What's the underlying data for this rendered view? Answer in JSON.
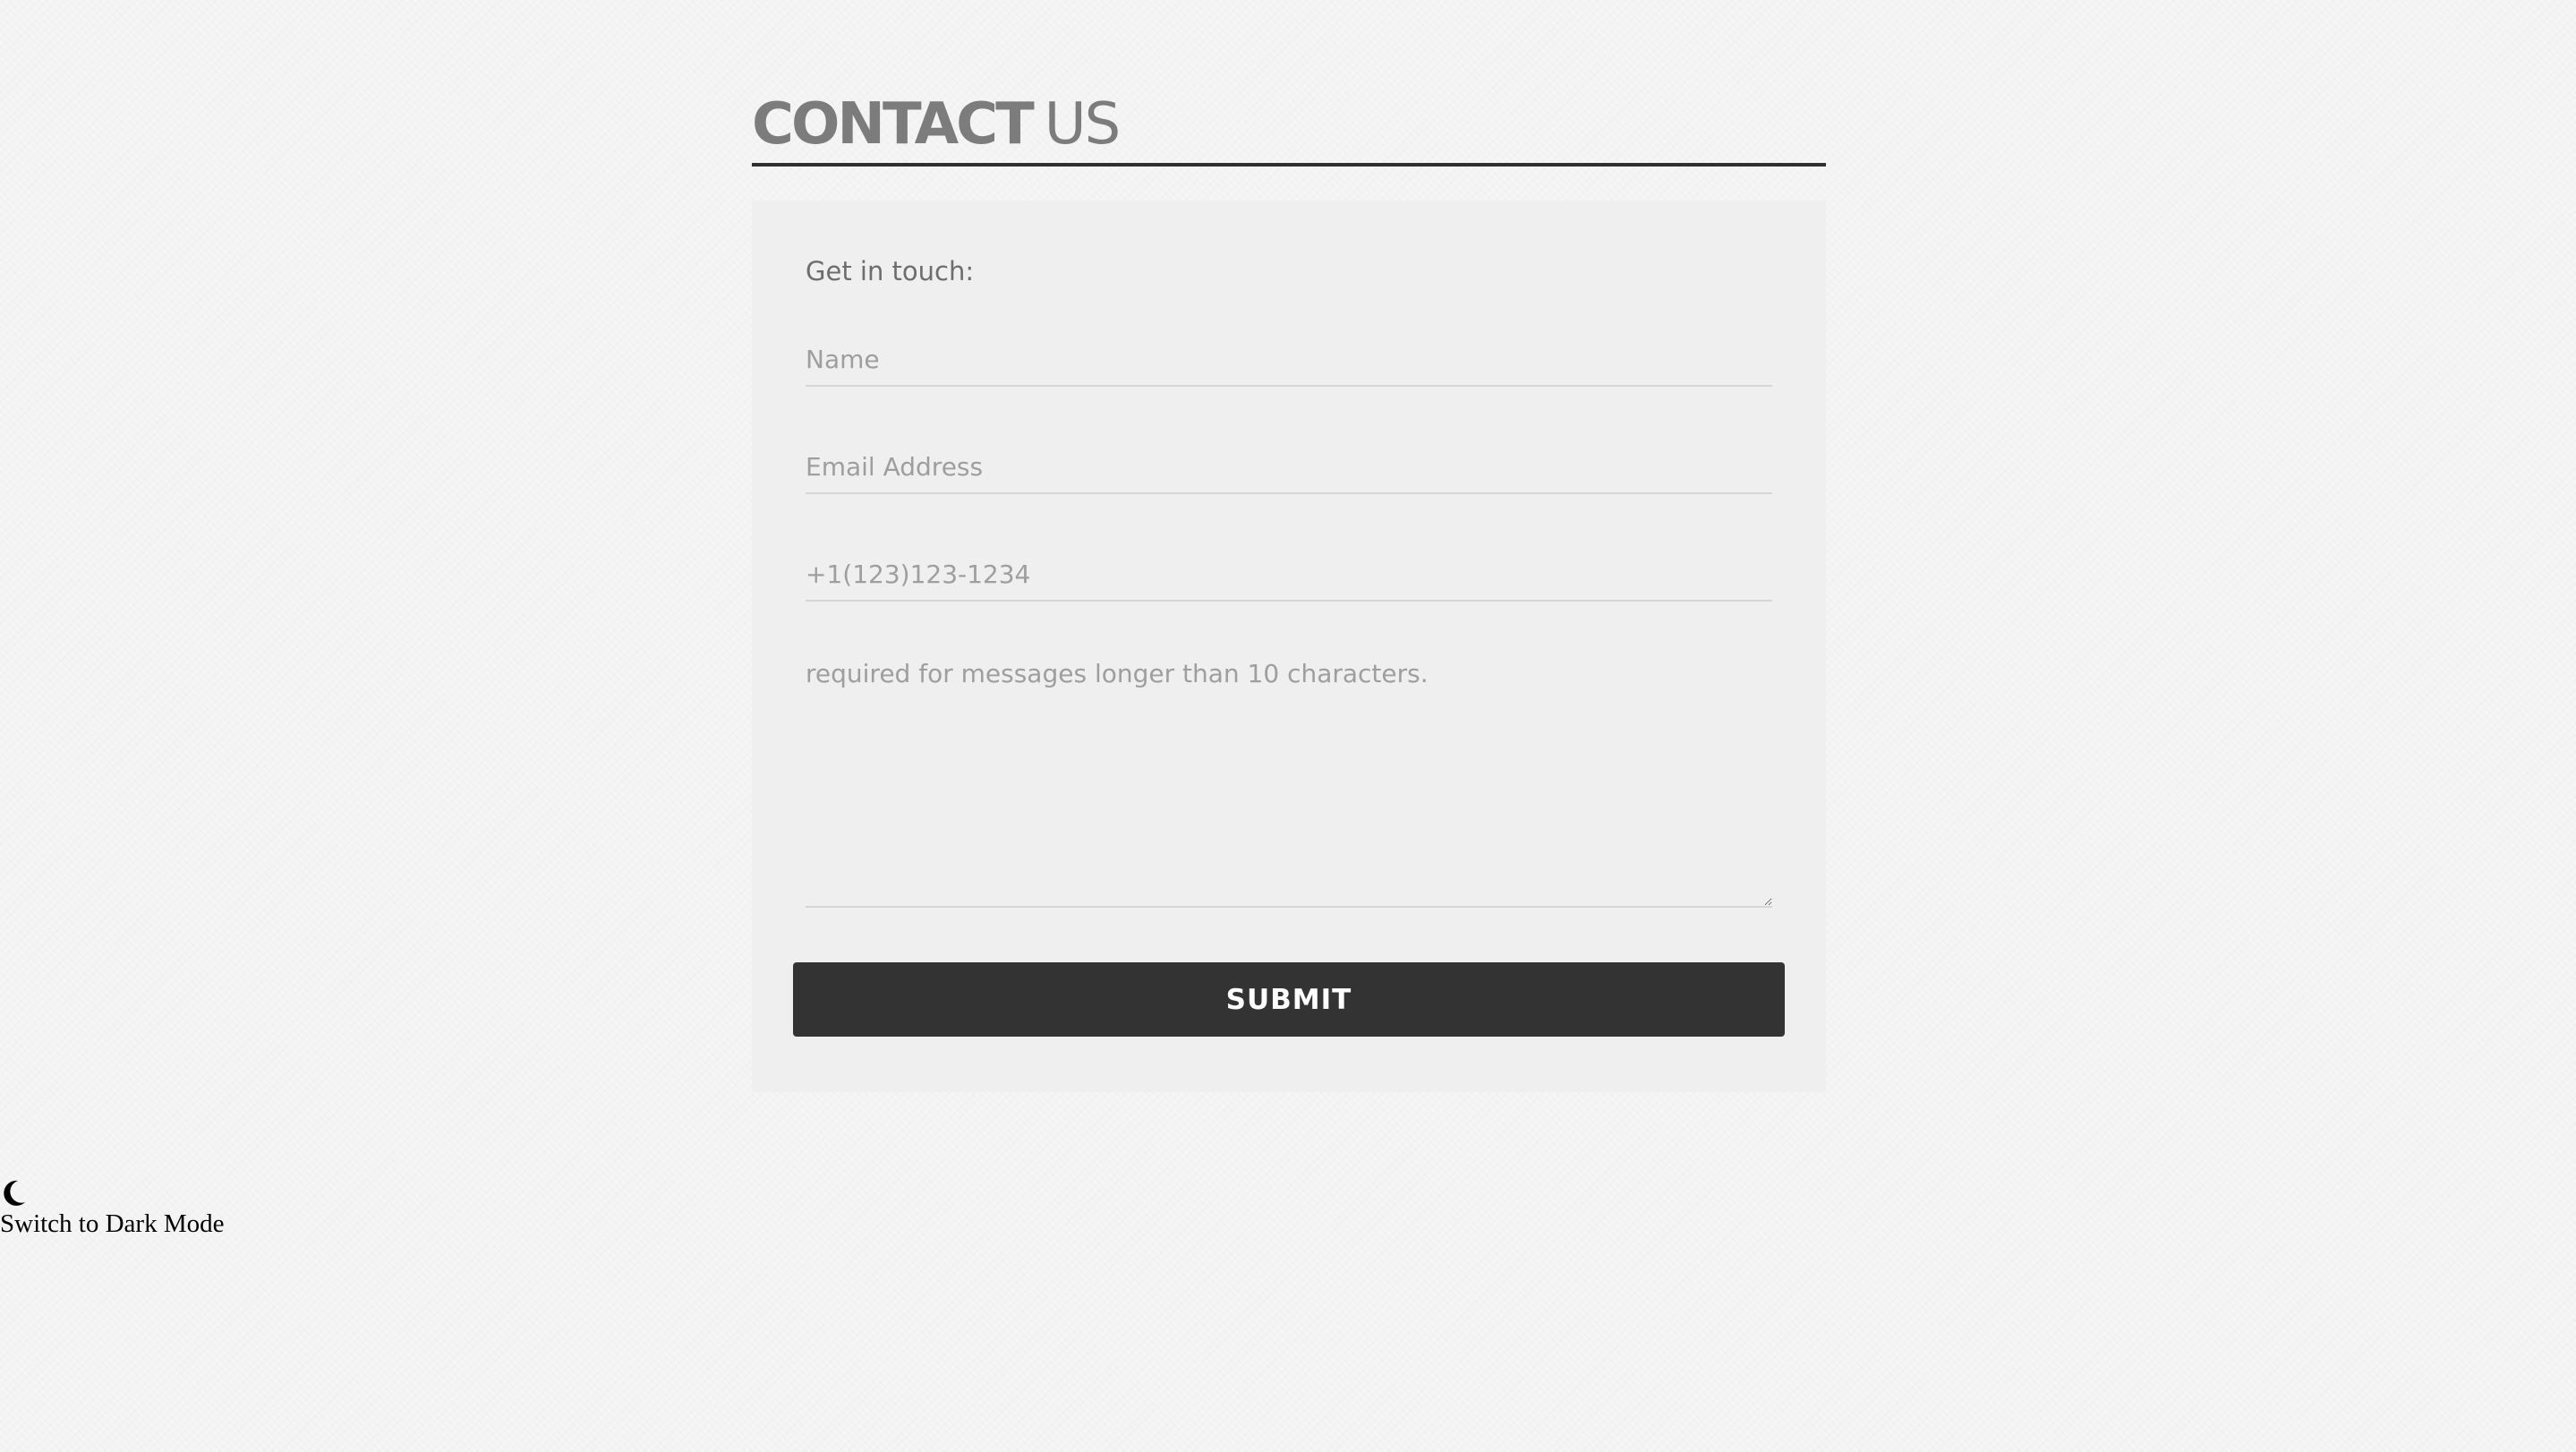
{
  "heading": {
    "strong": "CONTACT",
    "light": "US"
  },
  "form": {
    "intro": "Get in touch:",
    "name_placeholder": "Name",
    "email_placeholder": "Email Address",
    "phone_placeholder": "+1(123)123-1234",
    "message_placeholder": "required for messages longer than 10 characters.",
    "submit_label": "SUBMIT"
  },
  "theme_toggle": {
    "icon": "moon-icon",
    "label": "Switch to Dark Mode"
  },
  "colors": {
    "page_background": "#f5f5f5",
    "panel_background": "#efefef",
    "button_background": "#333333",
    "heading_text": "#7c7c7c",
    "rule": "#2f2f2f"
  }
}
